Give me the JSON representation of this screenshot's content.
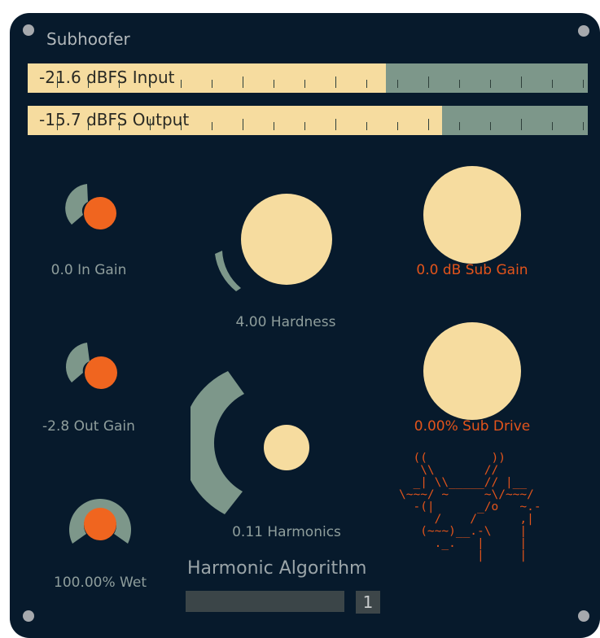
{
  "app": {
    "title": "Subhoofer"
  },
  "meters": {
    "input": {
      "label": "-21.6 dBFS Input",
      "level": 0.64
    },
    "output": {
      "label": "-15.7 dBFS Output",
      "level": 0.74
    }
  },
  "knobs": {
    "in_gain": {
      "label": "0.0 In Gain",
      "value": 0.5
    },
    "out_gain": {
      "label": "-2.8 Out Gain",
      "value": 0.45
    },
    "wet": {
      "label": "100.00% Wet",
      "value": 1.0
    },
    "hardness": {
      "label": "4.00 Hardness",
      "value": 0.12
    },
    "harmonics": {
      "label": "0.11 Harmonics",
      "value": 0.36
    },
    "sub_gain": {
      "label": "0.0 dB Sub Gain",
      "value": 0.5
    },
    "sub_drive": {
      "label": "0.00% Sub Drive",
      "value": 0.0
    }
  },
  "algorithm": {
    "title": "Harmonic Algorithm",
    "value": "1"
  },
  "logo_art": "  ((         ))\n   \\\\       //\n  _| \\\\_____// |__\n\\~~~/ ~     ~\\/~~~/\n  -(|      _/o   ~.-\n     /    /      ,|\n   (~~~)__.-\\    |\n     ._.   |     |\n           |     |",
  "colors": {
    "panel": "#071a2c",
    "cream": "#f6dc9f",
    "sage": "#7d978a",
    "accent": "#f0651f",
    "label": "#8f9e9c"
  },
  "icons": {
    "screw": "screw-icon"
  }
}
